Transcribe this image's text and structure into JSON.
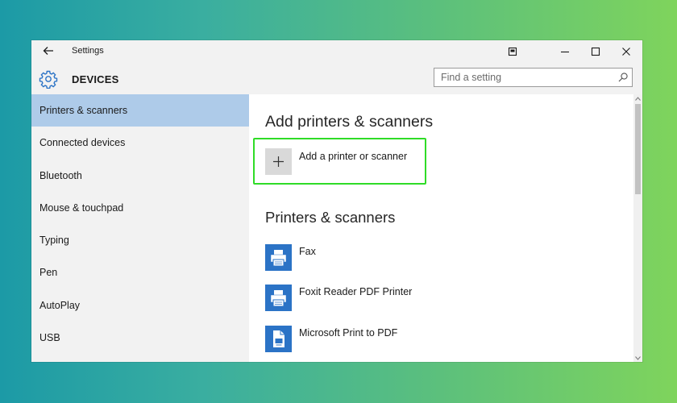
{
  "window": {
    "title": "Settings",
    "section": "DEVICES"
  },
  "titlebar": {
    "icons": [
      "back-arrow-icon",
      "snap-assist-icon",
      "minimize-icon",
      "maximize-icon",
      "close-icon"
    ]
  },
  "search": {
    "placeholder": "Find a setting",
    "value": ""
  },
  "sidebar": {
    "items": [
      {
        "label": "Printers & scanners",
        "selected": true
      },
      {
        "label": "Connected devices",
        "selected": false
      },
      {
        "label": "Bluetooth",
        "selected": false
      },
      {
        "label": "Mouse & touchpad",
        "selected": false
      },
      {
        "label": "Typing",
        "selected": false
      },
      {
        "label": "Pen",
        "selected": false
      },
      {
        "label": "AutoPlay",
        "selected": false
      },
      {
        "label": "USB",
        "selected": false
      }
    ]
  },
  "main": {
    "add_heading": "Add printers & scanners",
    "add_button_label": "Add a printer or scanner",
    "list_heading": "Printers & scanners",
    "printers": [
      {
        "name": "Fax",
        "icon": "fax-printer-icon"
      },
      {
        "name": "Foxit Reader PDF Printer",
        "icon": "printer-icon"
      },
      {
        "name": "Microsoft Print to PDF",
        "icon": "pdf-document-icon"
      }
    ]
  },
  "colors": {
    "selected_nav": "#aecbe9",
    "highlight_border": "#2fdc27",
    "printer_icon_bg": "#2b73c6",
    "gear_icon": "#2b73c6"
  }
}
